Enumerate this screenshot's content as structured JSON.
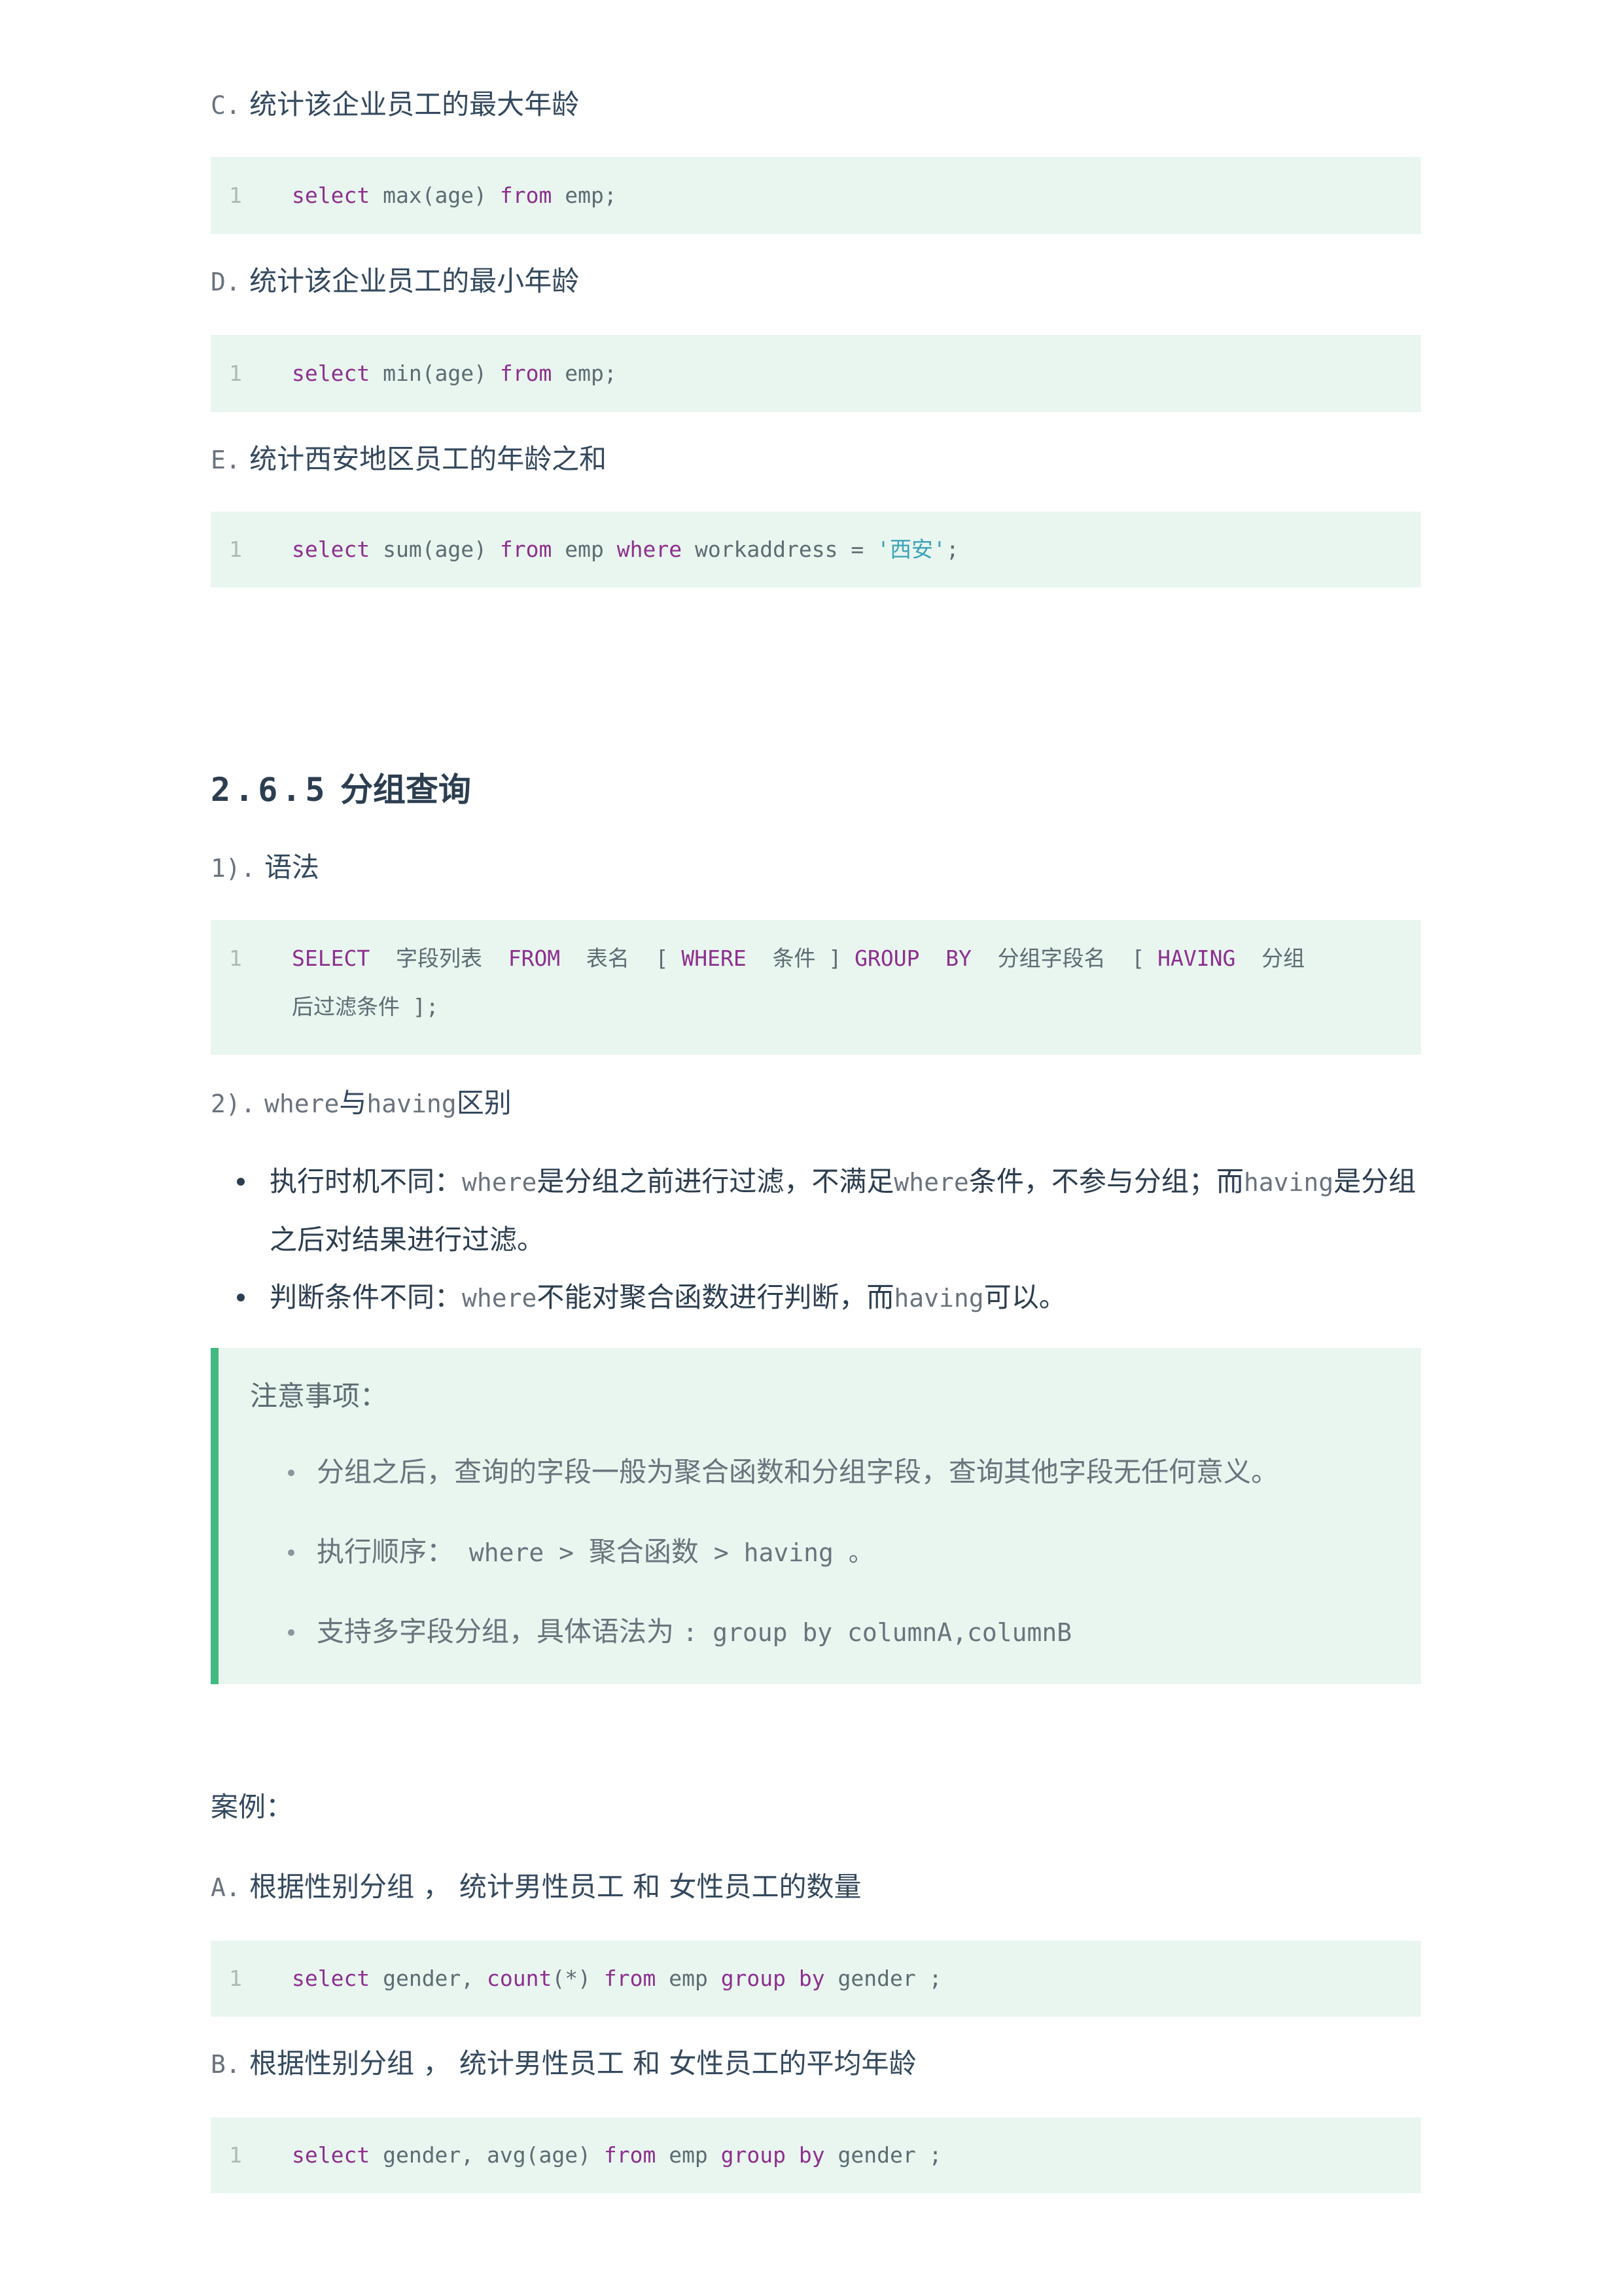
{
  "sections": {
    "c": {
      "prefix": "C.",
      "text": "统计该企业员工的最大年龄"
    },
    "d": {
      "prefix": "D.",
      "text": "统计该企业员工的最小年龄"
    },
    "e": {
      "prefix": "E.",
      "text": "统计西安地区员工的年龄之和"
    }
  },
  "code_c": {
    "line": "1",
    "kw1": "select",
    "t1": " max(age) ",
    "kw2": "from",
    "t2": " emp;"
  },
  "code_d": {
    "line": "1",
    "kw1": "select",
    "t1": " min(age) ",
    "kw2": "from",
    "t2": " emp;"
  },
  "code_e": {
    "line": "1",
    "kw1": "select",
    "t1": " sum(age) ",
    "kw2": "from",
    "t2": " emp ",
    "kw3": "where",
    "t3": " workaddress = ",
    "str": "'西安'",
    "t4": ";"
  },
  "heading": {
    "number": "2.6.5",
    "title": "分组查询"
  },
  "syntax": {
    "prefix": "1).",
    "label": "语法"
  },
  "code_syntax": {
    "line": "1",
    "kw1": "SELECT",
    "t1": "  字段列表  ",
    "kw2": "FROM",
    "t2": "  表名  [ ",
    "kw3": "WHERE",
    "t3": "  条件 ] ",
    "kw4": "GROUP",
    "t4": "  ",
    "kw5": "BY",
    "t5": "  分组字段名  [ ",
    "kw6": "HAVING",
    "t6": "  分组",
    "line2": "后过滤条件 ];"
  },
  "diff": {
    "prefix": "2).",
    "w1": "where",
    "t1": "与",
    "w2": "having",
    "t2": "区别"
  },
  "bullets": {
    "b1_a": "执行时机不同：",
    "b1_w": "where",
    "b1_b": "是分组之前进行过滤，不满足",
    "b1_w2": "where",
    "b1_c": "条件，不参与分组；而",
    "b1_h": "having",
    "b1_d": "是分组",
    "b1_line2": "之后对结果进行过滤。",
    "b2_a": "判断条件不同：",
    "b2_w": "where",
    "b2_b": "不能对聚合函数进行判断，而",
    "b2_h": "having",
    "b2_c": "可以。"
  },
  "tip": {
    "title": "注意事项：",
    "i1": "分组之后，查询的字段一般为聚合函数和分组字段，查询其他字段无任何意义。",
    "i2_a": "执行顺序：",
    "i2_c1": " where > ",
    "i2_b": "聚合函数",
    "i2_c2": " > having 。",
    "i3_a": "支持多字段分组，具体语法为 ",
    "i3_c": ": group by columnA,columnB"
  },
  "case_label": "案例：",
  "case_a": {
    "prefix": "A.",
    "text": "根据性别分组 ， 统计男性员工 和 女性员工的数量"
  },
  "code_a": {
    "line": "1",
    "kw1": "select",
    "t1": " gender, ",
    "kw2": "count",
    "t2": "(*) ",
    "kw3": "from",
    "t3": " emp ",
    "kw4": "group",
    "t4": " ",
    "kw5": "by",
    "t5": " gender ;"
  },
  "case_b": {
    "prefix": "B.",
    "text": "根据性别分组 ， 统计男性员工 和 女性员工的平均年龄"
  },
  "code_b": {
    "line": "1",
    "kw1": "select",
    "t1": " gender, avg(age) ",
    "kw2": "from",
    "t2": " emp ",
    "kw3": "group",
    "t3": " ",
    "kw4": "by",
    "t4": " gender ;"
  }
}
